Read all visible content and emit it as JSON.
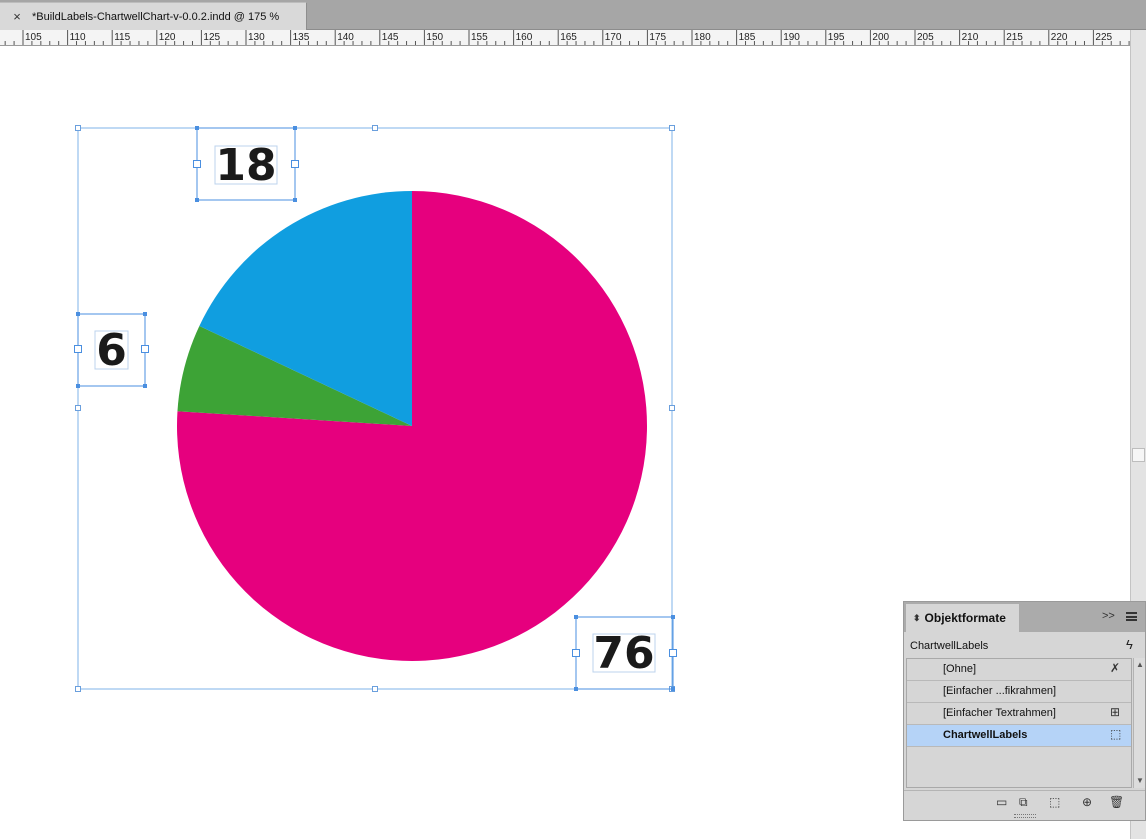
{
  "window": {
    "tab_close": "×",
    "tab_title": "*BuildLabels-ChartwellChart-v-0.0.2.indd @ 175 %"
  },
  "ruler": {
    "labels": [
      "105",
      "110",
      "115",
      "120",
      "125",
      "130",
      "135",
      "140",
      "145",
      "150",
      "155",
      "160",
      "165",
      "170",
      "175",
      "180",
      "185",
      "190",
      "195",
      "200",
      "205",
      "210",
      "215",
      "220",
      "225"
    ]
  },
  "chart_data": {
    "type": "pie",
    "categories": [
      "76",
      "6",
      "18"
    ],
    "values": [
      76,
      6,
      18
    ],
    "colors": [
      "#e6007e",
      "#3da336",
      "#109ee0"
    ],
    "title": "",
    "data_labels": [
      "18",
      "6",
      "76"
    ]
  },
  "panel": {
    "title": "Objektformate",
    "collapse_icon": "double-chevron-right-icon",
    "current_style": "ChartwellLabels",
    "items": [
      {
        "label": "[Ohne]",
        "icon": "clear-overrides-icon",
        "selected": false
      },
      {
        "label": "[Einfacher ...fikrahmen]",
        "icon": "",
        "selected": false
      },
      {
        "label": "[Einfacher Textrahmen]",
        "icon": "text-frame-icon",
        "selected": false
      },
      {
        "label": "ChartwellLabels",
        "icon": "dashed-frame-icon",
        "selected": true
      }
    ],
    "footer_icons": [
      "folder-icon",
      "clear-overrides-icon",
      "clear-attributes-icon",
      "new-style-icon",
      "trash-icon"
    ]
  }
}
